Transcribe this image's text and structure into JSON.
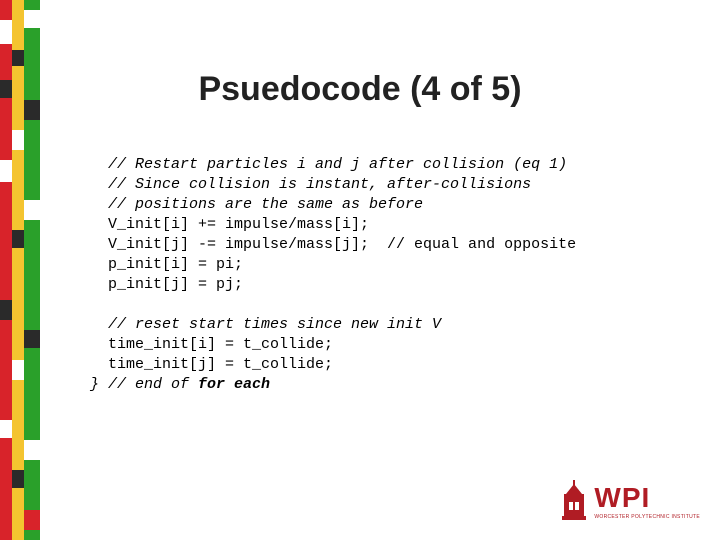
{
  "title": "Psuedocode (4 of 5)",
  "code": {
    "l1": "  // Restart particles i and j after collision (eq 1)",
    "l2": "  // Since collision is instant, after-collisions",
    "l3": "  // positions are the same as before",
    "l4": "  V_init[i] += impulse/mass[i];",
    "l5": "  V_init[j] -= impulse/mass[j];  // equal and opposite",
    "l6": "  p_init[i] = pi;",
    "l7": "  p_init[j] = pj;",
    "l8": "",
    "l9": "  // reset start times since new init V",
    "l10": "  time_init[i] = t_collide;",
    "l11": "  time_init[j] = t_collide;",
    "l12a": "} // end of ",
    "l12b": "for each"
  },
  "logo": {
    "text": "WPI",
    "sub": "WORCESTER POLYTECHNIC INSTITUTE"
  },
  "stripe_colors": {
    "red": "#d8232a",
    "yellow": "#f4c430",
    "green": "#2aa02a",
    "white": "#ffffff",
    "black": "#2a2a2a"
  }
}
